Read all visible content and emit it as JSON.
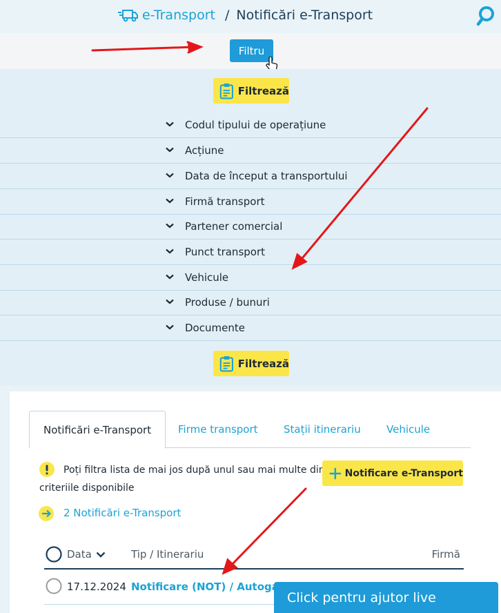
{
  "header": {
    "breadcrumb_root": "e-Transport",
    "separator": "/",
    "page_title": "Notificări e-Transport"
  },
  "filter_bar": {
    "filter_button_label": "Filtru"
  },
  "filter_panel": {
    "apply_button_label": "Filtrează",
    "criteria": [
      "Codul tipului de operațiune",
      "Acțiune",
      "Data de început a transportului",
      "Firmă transport",
      "Partener comercial",
      "Punct transport",
      "Vehicule",
      "Produse / bunuri",
      "Documente"
    ]
  },
  "tabs": [
    {
      "label": "Notificări e-Transport",
      "active": true
    },
    {
      "label": "Firme transport",
      "active": false
    },
    {
      "label": "Stații itinerariu",
      "active": false
    },
    {
      "label": "Vehicule",
      "active": false
    }
  ],
  "info_text": "Poți filtra lista de mai jos după unul sau mai multe din criteriile disponibile",
  "add_button_label": "Notificare e-Transport",
  "count_text": "2 Notificări e-Transport",
  "table": {
    "columns": [
      "Data",
      "Tip / Itinerariu",
      "Firmă"
    ],
    "rows": [
      {
        "date": "17.12.2024",
        "type": "Notificare (NOT) / Autogara S"
      }
    ]
  },
  "help_chat_label": "Click pentru ajutor live",
  "colors": {
    "accent_blue": "#1e9bd8",
    "link_blue": "#1aa3d6",
    "yellow_button": "#fbe64a",
    "annotation_arrow": "#e3171a"
  },
  "icons": [
    "truck-icon",
    "search-icon",
    "clipboard-icon",
    "chevron-down-icon",
    "info-icon",
    "arrow-right-icon",
    "plus-icon",
    "radio-icon",
    "pointer-cursor-icon"
  ]
}
